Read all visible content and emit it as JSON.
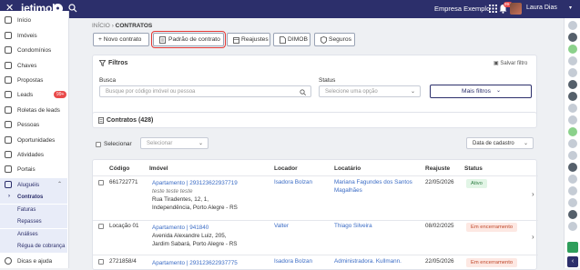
{
  "topbar": {
    "close": "✕",
    "logo": "jetimob",
    "logo_badge": "●",
    "company": "Empresa Exemplo",
    "bell_badge": "99+",
    "user": "Laura Dias",
    "chevron": "▾"
  },
  "sidebar": {
    "items": [
      {
        "label": "Início"
      },
      {
        "label": "Imóveis"
      },
      {
        "label": "Condomínios"
      },
      {
        "label": "Chaves"
      },
      {
        "label": "Propostas"
      },
      {
        "label": "Leads",
        "badge": "99+"
      },
      {
        "label": "Roletas de leads"
      },
      {
        "label": "Pessoas"
      },
      {
        "label": "Oportunidades"
      },
      {
        "label": "Atividades"
      },
      {
        "label": "Portais"
      },
      {
        "label": "Aluguéis",
        "caret": "⌃"
      }
    ],
    "sub_items": [
      {
        "label": "Contratos",
        "arrow": "›"
      },
      {
        "label": "Faturas"
      },
      {
        "label": "Repasses"
      },
      {
        "label": "Análises"
      },
      {
        "label": "Régua de cobrança"
      }
    ],
    "bottom": {
      "label": "Dicas e ajuda"
    }
  },
  "breadcrumb": {
    "root": "INÍCIO",
    "sep": "›",
    "current": "CONTRATOS"
  },
  "toolbar": {
    "new_contract": "+ Novo contrato",
    "default_contract": "Padrão de contrato",
    "adjustments": "Reajustes",
    "dimob": "DIMOB",
    "insurance": "Seguros"
  },
  "filters": {
    "title": "Filtros",
    "save": "Salvar filtro",
    "search_label": "Busca",
    "search_placeholder": "Busque por código imóvel ou pessoa",
    "status_label": "Status",
    "status_placeholder": "Selecione uma opção",
    "more": "Mais filtros"
  },
  "contracts": {
    "title": "Contratos (428)",
    "select_label": "Selecionar",
    "bulk_placeholder": "Selecionar",
    "sort_value": "Data de cadastro"
  },
  "table": {
    "headers": [
      "Código",
      "Imóvel",
      "Locador",
      "Locatário",
      "Reajuste",
      "Status"
    ],
    "rows": [
      {
        "code": "661722771",
        "property_link": "Apartamento | 293123622937719",
        "property_note": "teste teste teste",
        "address_1": "Rua Tiradentes, 12, 1,",
        "address_2": "Independência, Porto Alegre - RS",
        "landlord": "Isadora Bolzan",
        "tenant_1": "Mariana Fagundes dos Santos",
        "tenant_2": "Magalhães",
        "adjustment": "22/05/2026",
        "status": "Ativo",
        "status_kind": "ativo"
      },
      {
        "code": "Locação 01",
        "property_link": "Apartamento | 941840",
        "address_1": "Avenida Alexandre Luiz, 205,",
        "address_2": "Jardim Sabará, Porto Alegre - RS",
        "landlord": "Valter",
        "tenant_1": "Thiago Silveira",
        "adjustment": "08/02/2025",
        "status": "Em encerramento",
        "status_kind": "enc"
      },
      {
        "code": "2721858/4",
        "property_link": "Apartamento | 293123622937775",
        "landlord": "Isadora Bolzan",
        "tenant_1": "Administradora. Kullmann.",
        "adjustment": "22/05/2026",
        "status": "Em encerramento",
        "status_kind": "enc"
      }
    ]
  }
}
